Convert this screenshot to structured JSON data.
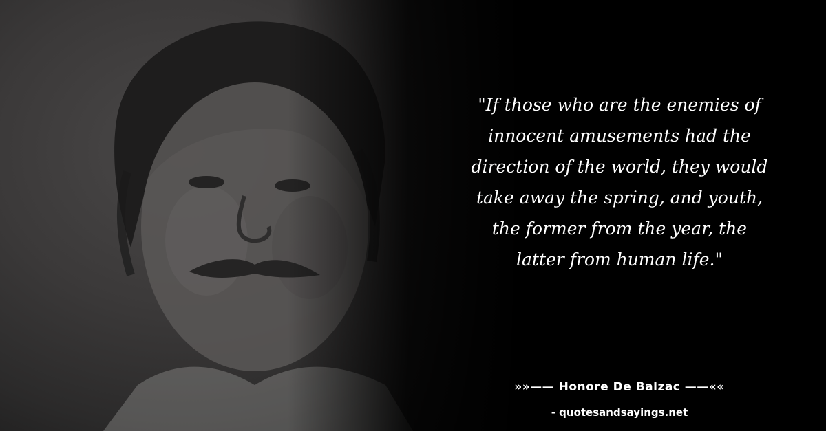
{
  "quote": {
    "text": "\"If those who are the enemies of\ninnocent amusements had the\ndirection of the world, they would\ntake away the spring, and youth,\nthe former from the year, the\nlatter from human life.\""
  },
  "author": {
    "line": "»»—— Honore De Balzac ——««"
  },
  "source": {
    "text": "- quotesandsayings.net"
  }
}
